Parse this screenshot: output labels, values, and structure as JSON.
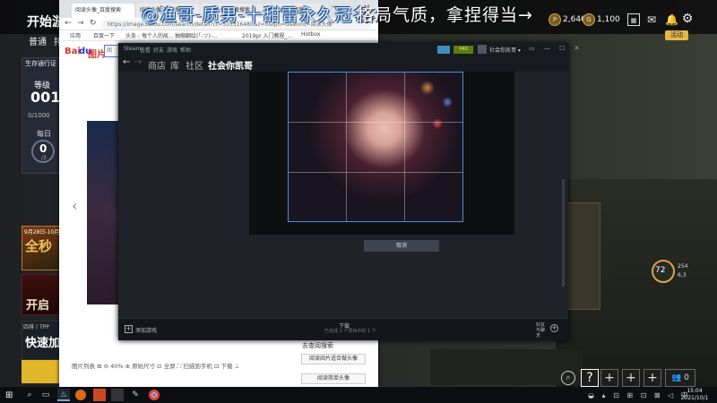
{
  "game": {
    "title": "开始游",
    "tabs": {
      "normal": "普通",
      "rank": "排"
    },
    "banner_blue": "@渔哥-质男-十甜雷永久冠名：",
    "banner_white": "格局气质，拿捏得当→",
    "currency1": "2,646",
    "currency2": "1,100",
    "event_badge": "活动",
    "battle_pass": {
      "title": "生存通行证",
      "level_label": "等级",
      "level": "001",
      "xp": "0/1000",
      "daily_label": "每日",
      "daily_value": "0",
      "daily_max": "/3"
    },
    "promos": {
      "p1_date": "9月28日-10月",
      "p1_text": "全秒",
      "p2_text": "开启",
      "p3_tag": "四排丨TPP",
      "p3_text": "快速加"
    },
    "player_level": "72",
    "player_info1": "254",
    "player_info2": "6,3",
    "buttons": {
      "help": "?",
      "add": "+",
      "party": "👥 0"
    }
  },
  "browser": {
    "tabs": [
      "阅读头像_百度搜索",
      "阅读头像_百度搜索",
      "阅读头像_百度搜索",
      "阅读头像_百度"
    ],
    "url": "https://image.baidu.com/search/detail?ct=503316480&z=0&ipn=d&word=阅读头像",
    "bookmarks": {
      "apps": "应用",
      "baidu": "百度一下",
      "toutiao": "头条 - 每个人的故...",
      "deepin": "抽缩翻绘(「-ツ)-...",
      "y2019": "2019pr 入门教程_...",
      "hotbox": "Hotbox"
    },
    "logo_bai": "Bai",
    "logo_du": "du",
    "logo_pic": "图片",
    "search_placeholder": "阅",
    "toolbar": "图片列表 ⊞  ⊖ 40% ⊕  原始尺寸 ⊡  全屏 ⛶  扫描到手机 ⊡  下载 ⊥",
    "related_title": "去查阅搜索",
    "related1": "阅读阅片适合做头像",
    "related2": "阅读简单头像"
  },
  "steam": {
    "menu": [
      "Steam",
      "查看",
      "好友",
      "游戏",
      "帮助"
    ],
    "wallet": "¥40",
    "user": "社会你凯哥 ▾",
    "window_controls": "▭ — ☐ ✕",
    "nav": {
      "store": "商店",
      "library": "库",
      "community": "社区",
      "user": "社会你凯哥"
    },
    "cancel": "取消",
    "add_game": "添加游戏",
    "download": "下载",
    "download_sub": "已完成 1 个项目中的 1 个",
    "friends": "好友与聊天"
  },
  "taskbar": {
    "tray": "◒ ▴ ⊡ ⊞ ⊡ ⊠ ◁ 中",
    "time": "15:04",
    "date": "2021/10/1"
  }
}
